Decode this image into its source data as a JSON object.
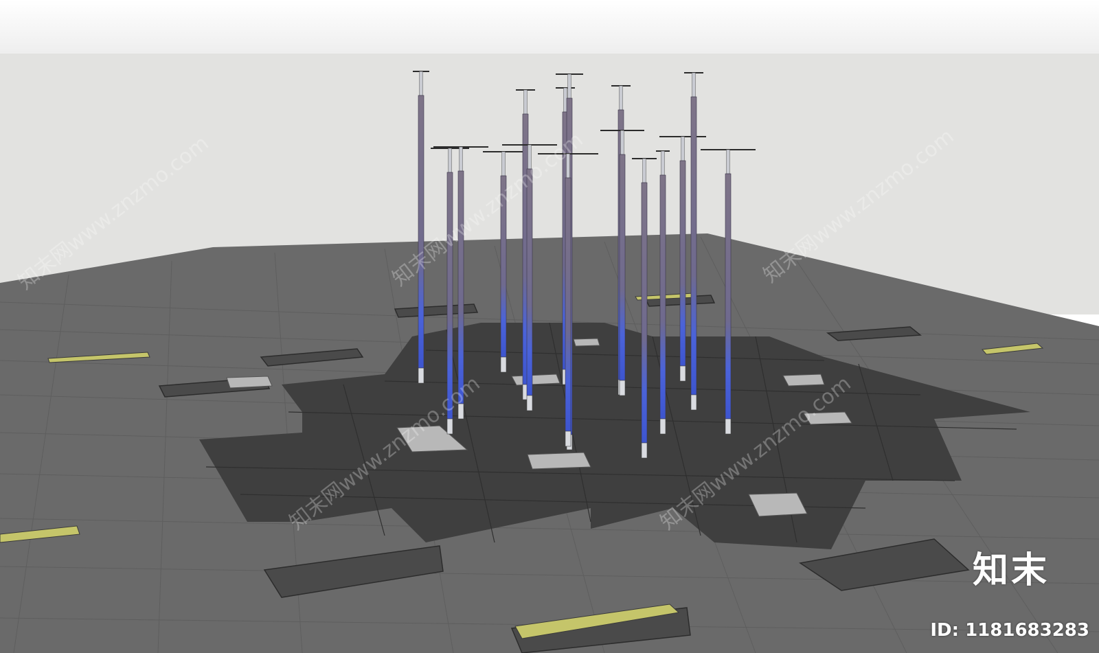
{
  "scene": {
    "colors": {
      "wall": "#e2e2e0",
      "floor": "#6b6b6b",
      "dark_patch": "#3d3d3d",
      "pole_body": "#7e7488",
      "pole_glow": "#4b63d9",
      "pole_base": "#d9dbe0",
      "yellow_strip": "#c6c66a",
      "crossarm": "#2b2b2b"
    },
    "object": "light-poles",
    "pole_count": 16
  },
  "watermark": {
    "text": "知末网www.znzmo.com"
  },
  "branding": {
    "logo_text": "知末",
    "id_text": "ID: 1181683283"
  }
}
